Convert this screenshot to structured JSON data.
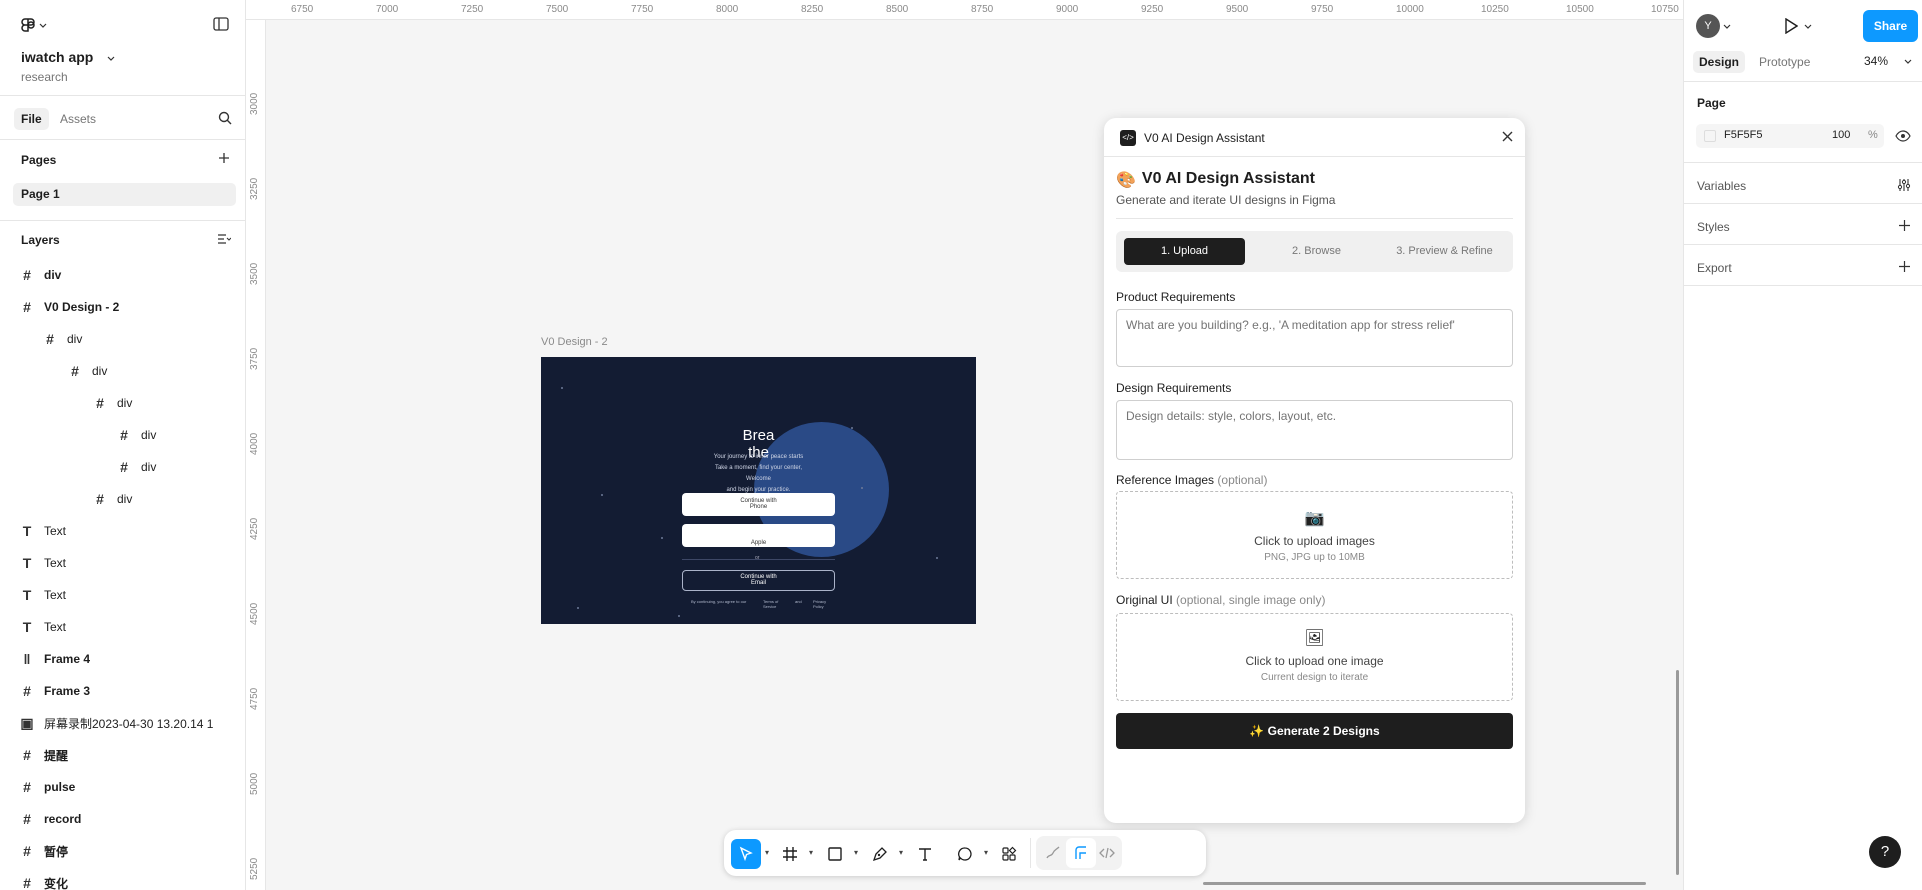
{
  "left_panel": {
    "project_title": "iwatch app",
    "project_subtitle": "research",
    "tab_file": "File",
    "tab_assets": "Assets",
    "pages_title": "Pages",
    "page_item": "Page 1",
    "layers_title": "Layers",
    "layers": [
      {
        "label": "div",
        "icon": "frame-icon"
      },
      {
        "label": "V0 Design - 2",
        "icon": "frame-icon"
      },
      {
        "label": "div",
        "icon": "frame-icon"
      },
      {
        "label": "div",
        "icon": "frame-icon"
      },
      {
        "label": "div",
        "icon": "frame-icon"
      },
      {
        "label": "div",
        "icon": "frame-icon"
      },
      {
        "label": "div",
        "icon": "frame-icon"
      },
      {
        "label": "div",
        "icon": "frame-icon"
      },
      {
        "label": "Text",
        "icon": "text-icon"
      },
      {
        "label": "Text",
        "icon": "text-icon"
      },
      {
        "label": "Text",
        "icon": "text-icon"
      },
      {
        "label": "Text",
        "icon": "text-icon"
      },
      {
        "label": "Frame 4",
        "icon": "auto-layout-icon"
      },
      {
        "label": "Frame 3",
        "icon": "frame-icon"
      },
      {
        "label": "屏幕录制2023-04-30 13.20.14 1",
        "icon": "video-icon"
      },
      {
        "label": "提醒",
        "icon": "frame-icon"
      },
      {
        "label": "pulse",
        "icon": "frame-icon"
      },
      {
        "label": "record",
        "icon": "frame-icon"
      },
      {
        "label": "暂停",
        "icon": "frame-icon"
      },
      {
        "label": "变化",
        "icon": "frame-icon"
      }
    ]
  },
  "ruler": {
    "top": [
      "6750",
      "7000",
      "7250",
      "7500",
      "7750",
      "8000",
      "8250",
      "8500",
      "8750",
      "9000",
      "9250",
      "9500",
      "9750",
      "10000",
      "10250",
      "10500",
      "10750"
    ],
    "left": [
      "3000",
      "3250",
      "3500",
      "3750",
      "4000",
      "4250",
      "4500",
      "4750",
      "5000",
      "5250"
    ]
  },
  "canvas": {
    "frame_label": "V0 Design - 2",
    "preview": {
      "headline_1": "Brea",
      "headline_2": "the",
      "line_1": "Your journey to inner peace starts",
      "line_2": "Take a moment, find your center,",
      "line_3": "Welcome",
      "line_4": "and begin your practice.",
      "btn_1": "Continue with",
      "btn_1b": "Phone",
      "btn_2": "Apple",
      "or": "or",
      "btn_3": "Continue with",
      "btn_3b": "Email",
      "footer_1": "By continuing, you agree to our",
      "footer_2": "Terms of Service",
      "footer_3": "and",
      "footer_4": "Privacy Policy"
    }
  },
  "plugin": {
    "window_title": "V0 AI Design Assistant",
    "heading_emoji": "🎨",
    "heading": "V0 AI Design Assistant",
    "subheading": "Generate and iterate UI designs in Figma",
    "steps": [
      "1. Upload",
      "2. Browse",
      "3. Preview & Refine"
    ],
    "product_label": "Product Requirements",
    "product_placeholder": "What are you building? e.g., 'A meditation app for stress relief'",
    "design_label": "Design Requirements",
    "design_placeholder": "Design details: style, colors, layout, etc.",
    "ref_label": "Reference Images",
    "ref_optional": "(optional)",
    "ref_emoji": "📷",
    "ref_cta": "Click to upload images",
    "ref_hint": "PNG, JPG up to 10MB",
    "orig_label": "Original UI",
    "orig_optional": "(optional, single image only)",
    "orig_emoji": "🖼",
    "orig_cta": "Click to upload one image",
    "orig_hint": "Current design to iterate",
    "generate_button": "✨ Generate 2 Designs"
  },
  "right_panel": {
    "avatar_letter": "Y",
    "share": "Share",
    "tab_design": "Design",
    "tab_prototype": "Prototype",
    "zoom": "34%",
    "page_section": "Page",
    "page_color": "F5F5F5",
    "page_opacity": "100",
    "percent": "%",
    "variables": "Variables",
    "styles": "Styles",
    "export": "Export"
  },
  "help": "?",
  "colors": {
    "accent": "#0d99ff",
    "dark": "#1e1e1e",
    "frame_bg": "#131c33",
    "circle": "#2a4a86"
  }
}
